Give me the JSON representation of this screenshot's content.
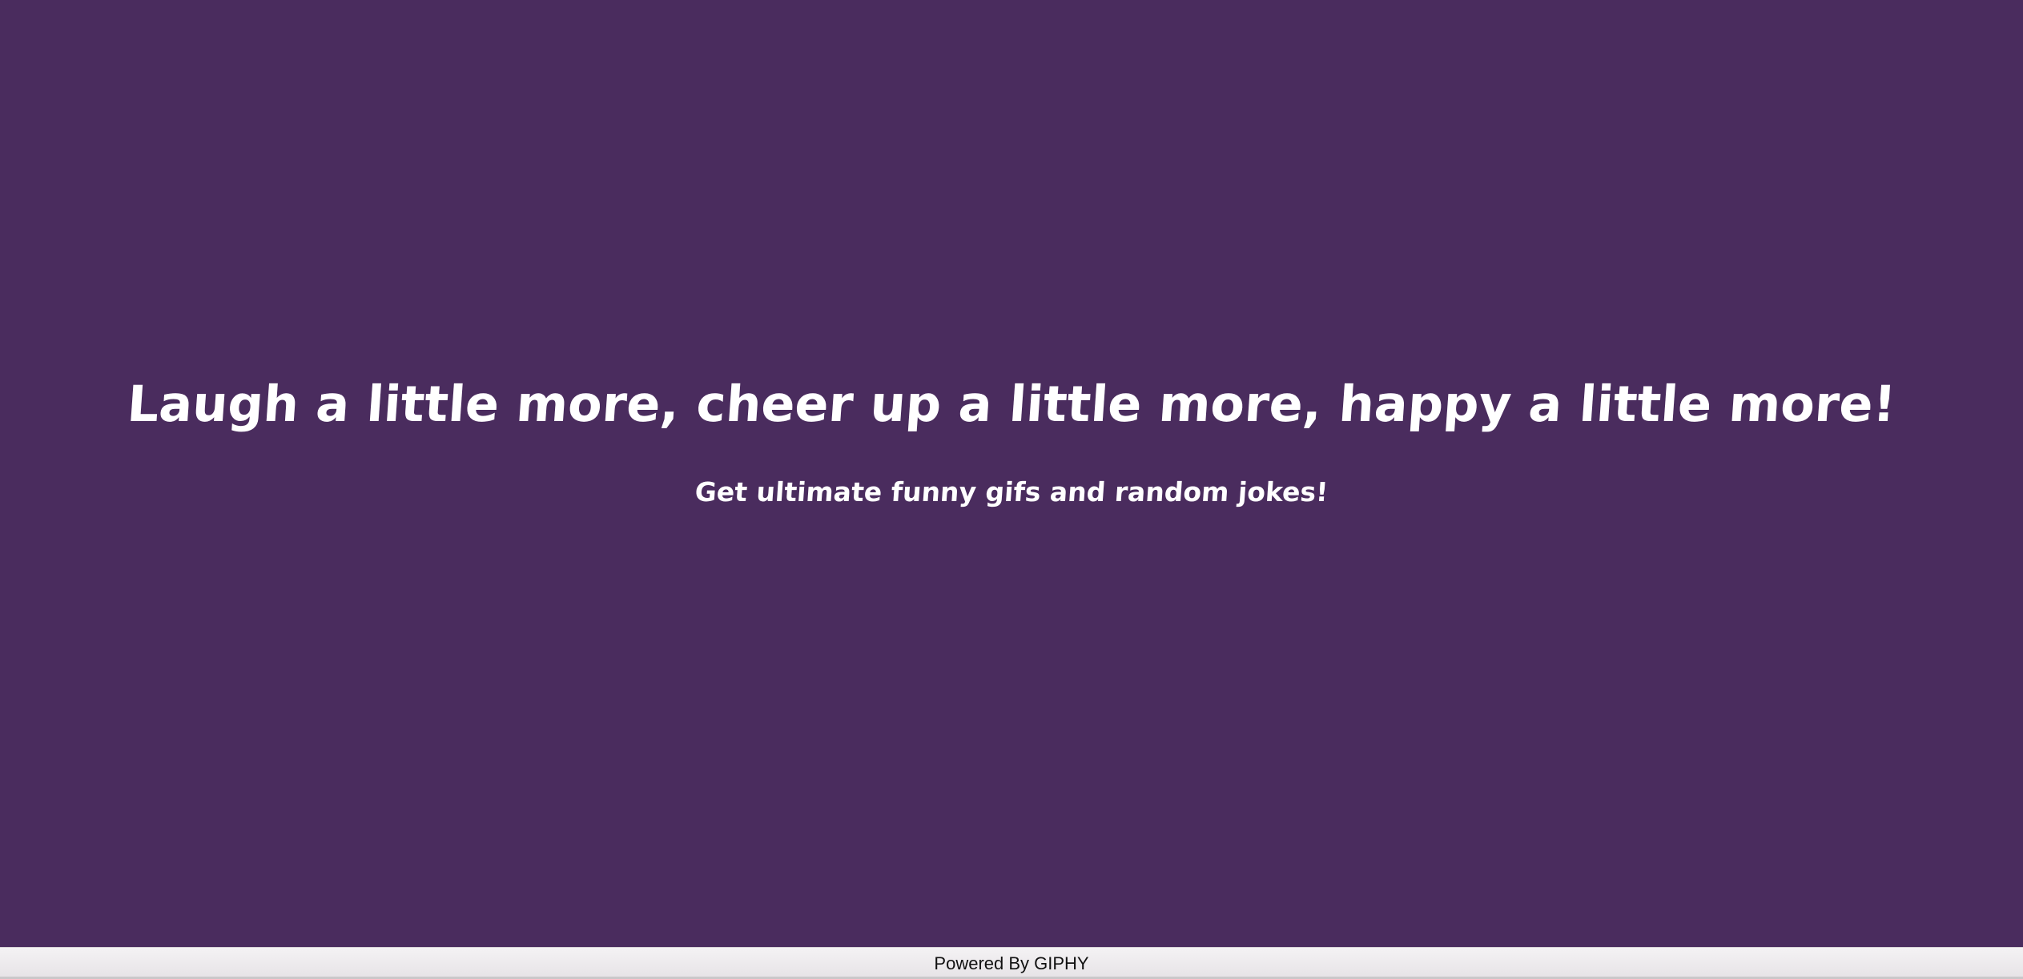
{
  "colors": {
    "background": "#4a2c5e",
    "text": "#ffffff",
    "footer_background": "#efedef",
    "footer_text": "#111111"
  },
  "hero": {
    "headline": "Laugh a little more, cheer up a little more, happy a little more!",
    "subline": "Get ultimate funny gifs and random jokes!"
  },
  "footer": {
    "powered_by": "Powered By GIPHY"
  }
}
